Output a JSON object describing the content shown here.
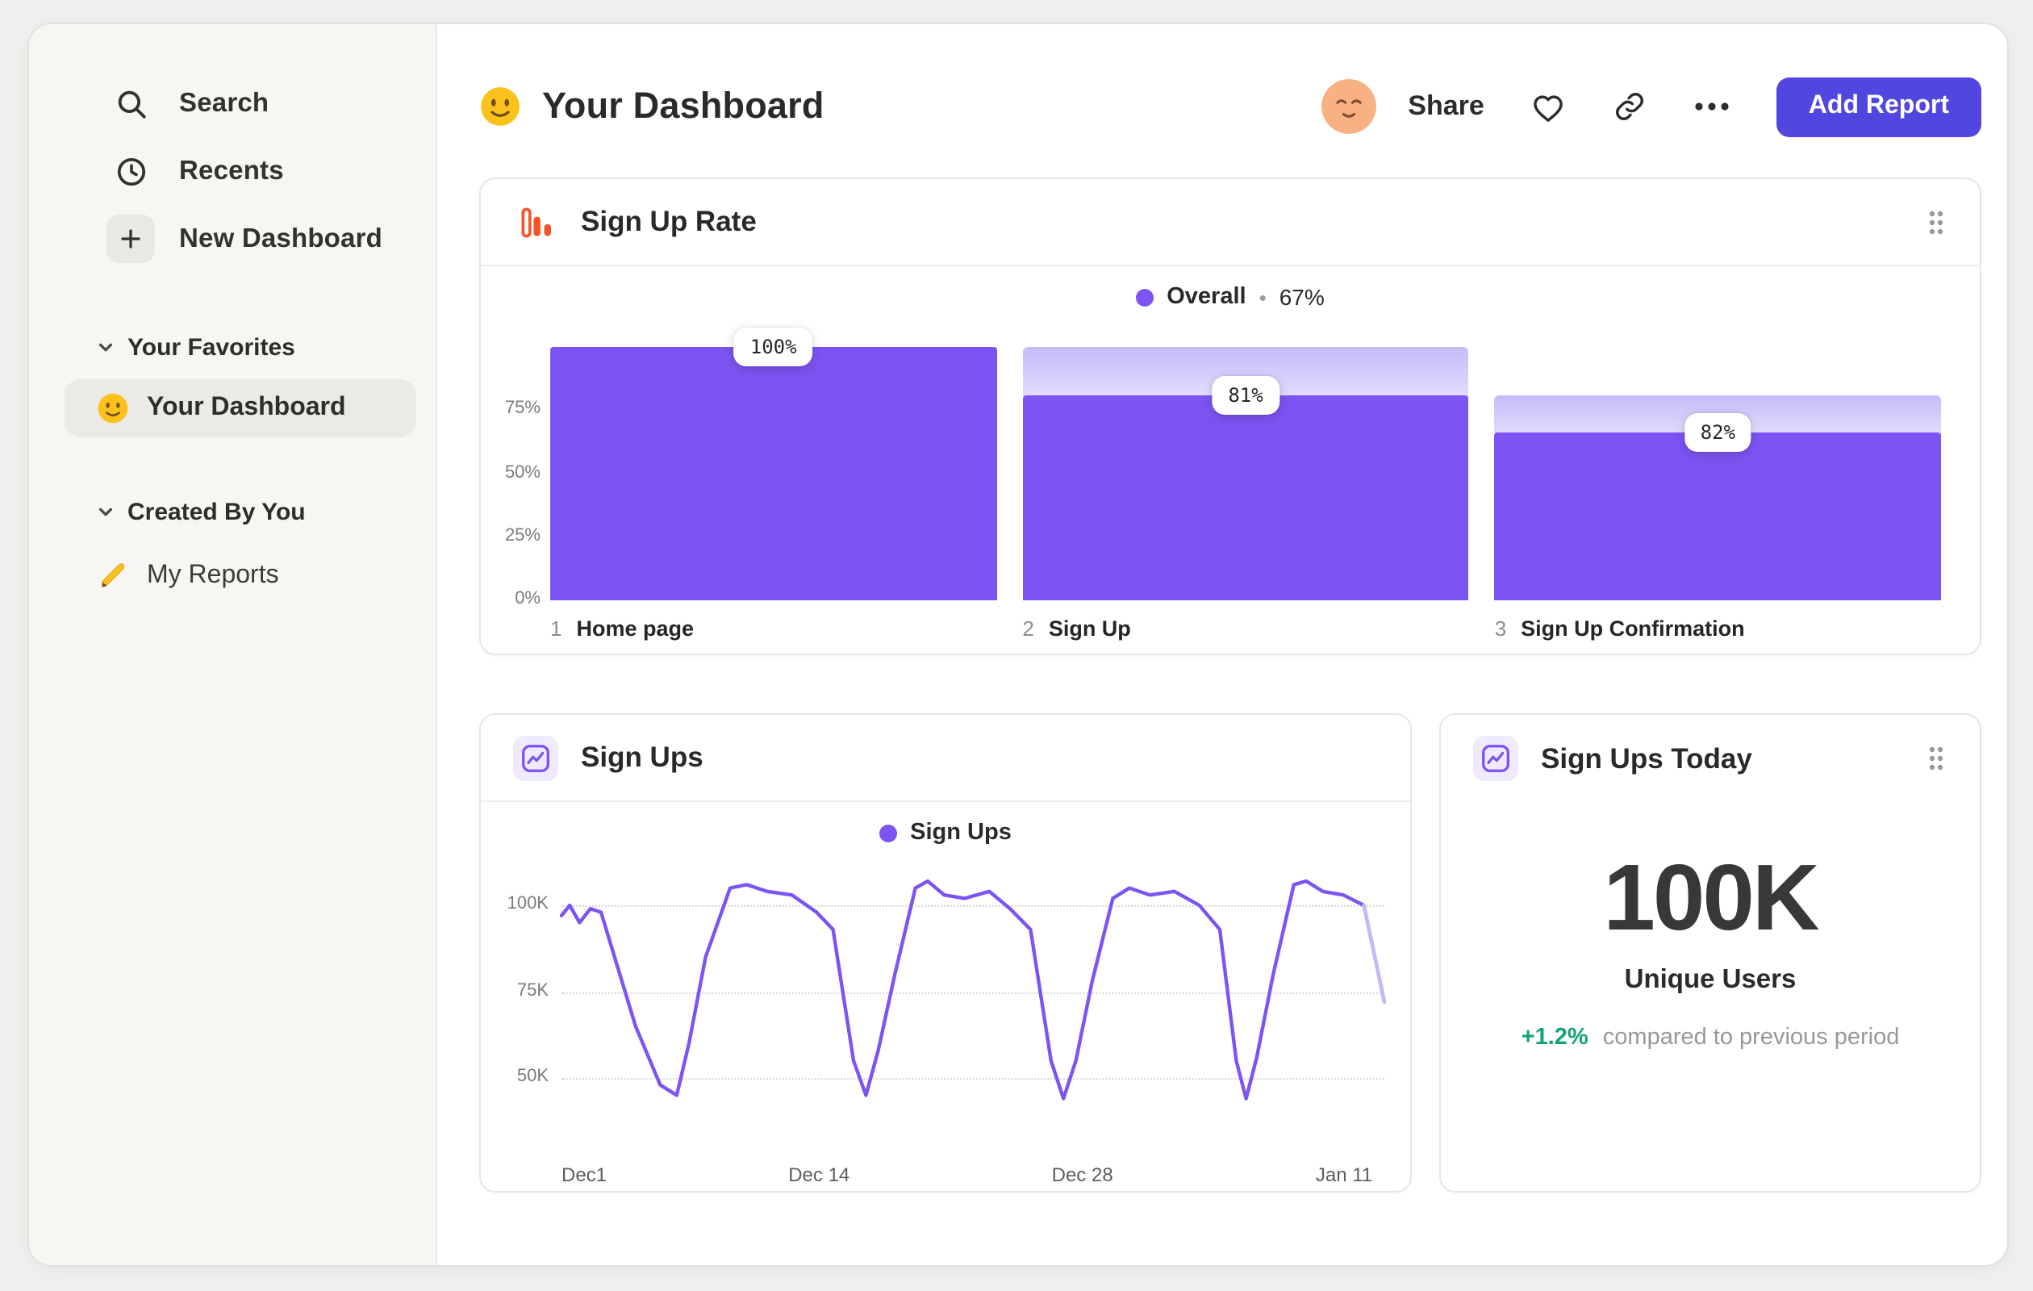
{
  "app": {
    "accent_purple": "#7c54f3",
    "button_purple": "#5246e0",
    "funnel_icon_orange": "#f4562a",
    "delta_green": "#13a276"
  },
  "sidebar": {
    "search_label": "Search",
    "recents_label": "Recents",
    "new_dashboard_label": "New Dashboard",
    "favorites_header": "Your Favorites",
    "favorites_items": [
      {
        "label": "Your Dashboard",
        "selected": true
      }
    ],
    "created_header": "Created By You",
    "created_items": [
      {
        "label": "My Reports"
      }
    ]
  },
  "header": {
    "title": "Your Dashboard",
    "share_label": "Share",
    "add_report_label": "Add Report"
  },
  "chart_data": [
    {
      "type": "bar",
      "variant": "funnel",
      "title": "Sign Up Rate",
      "legend_label": "Overall",
      "legend_separator": "•",
      "legend_value": "67%",
      "y_ticks": [
        "75%",
        "50%",
        "25%",
        "0%"
      ],
      "y_tick_values": [
        75,
        50,
        25,
        0
      ],
      "categories": [
        "Home page",
        "Sign Up",
        "Sign Up Confirmation"
      ],
      "steps": [
        {
          "number": "1",
          "name": "Home page",
          "rate_label": "100%",
          "ghost_pct": 100,
          "fill_pct": 100
        },
        {
          "number": "2",
          "name": "Sign Up",
          "rate_label": "81%",
          "ghost_pct": 100,
          "fill_pct": 81
        },
        {
          "number": "3",
          "name": "Sign Up Confirmation",
          "rate_label": "82%",
          "ghost_pct": 81,
          "fill_pct": 66.5
        }
      ]
    },
    {
      "type": "line",
      "title": "Sign Ups",
      "legend_label": "Sign Ups",
      "ylabel": "",
      "unit": "K",
      "ylim": [
        28,
        111
      ],
      "y_ticks": [
        {
          "label": "100K",
          "value": 100
        },
        {
          "label": "75K",
          "value": 75
        },
        {
          "label": "50K",
          "value": 50
        }
      ],
      "x_ticks": [
        {
          "label": "Dec1",
          "frac": 0.0,
          "anchor": "start"
        },
        {
          "label": "Dec 14",
          "frac": 0.313,
          "anchor": "middle"
        },
        {
          "label": "Dec 28",
          "frac": 0.633,
          "anchor": "middle"
        },
        {
          "label": "Jan 11",
          "frac": 0.951,
          "anchor": "middle"
        }
      ],
      "points": [
        [
          0.0,
          97
        ],
        [
          0.01,
          100
        ],
        [
          0.022,
          95
        ],
        [
          0.035,
          99
        ],
        [
          0.048,
          98
        ],
        [
          0.09,
          65
        ],
        [
          0.12,
          48
        ],
        [
          0.14,
          45
        ],
        [
          0.155,
          60
        ],
        [
          0.175,
          85
        ],
        [
          0.205,
          105
        ],
        [
          0.225,
          106
        ],
        [
          0.25,
          104
        ],
        [
          0.28,
          103
        ],
        [
          0.31,
          98
        ],
        [
          0.33,
          93
        ],
        [
          0.355,
          55
        ],
        [
          0.37,
          45
        ],
        [
          0.385,
          58
        ],
        [
          0.405,
          80
        ],
        [
          0.43,
          105
        ],
        [
          0.445,
          107
        ],
        [
          0.465,
          103
        ],
        [
          0.49,
          102
        ],
        [
          0.52,
          104
        ],
        [
          0.545,
          99
        ],
        [
          0.57,
          93
        ],
        [
          0.595,
          55
        ],
        [
          0.61,
          44
        ],
        [
          0.625,
          55
        ],
        [
          0.645,
          78
        ],
        [
          0.67,
          102
        ],
        [
          0.69,
          105
        ],
        [
          0.715,
          103
        ],
        [
          0.745,
          104
        ],
        [
          0.775,
          100
        ],
        [
          0.8,
          93
        ],
        [
          0.82,
          55
        ],
        [
          0.832,
          44
        ],
        [
          0.845,
          56
        ],
        [
          0.865,
          80
        ],
        [
          0.89,
          106
        ],
        [
          0.905,
          107
        ],
        [
          0.925,
          104
        ],
        [
          0.95,
          103
        ],
        [
          0.975,
          100
        ],
        [
          1.0,
          72
        ]
      ]
    },
    {
      "type": "metric",
      "title": "Sign Ups Today",
      "value": "100K",
      "caption": "Unique Users",
      "delta": "+1.2%",
      "delta_caption": "compared to previous period"
    }
  ]
}
